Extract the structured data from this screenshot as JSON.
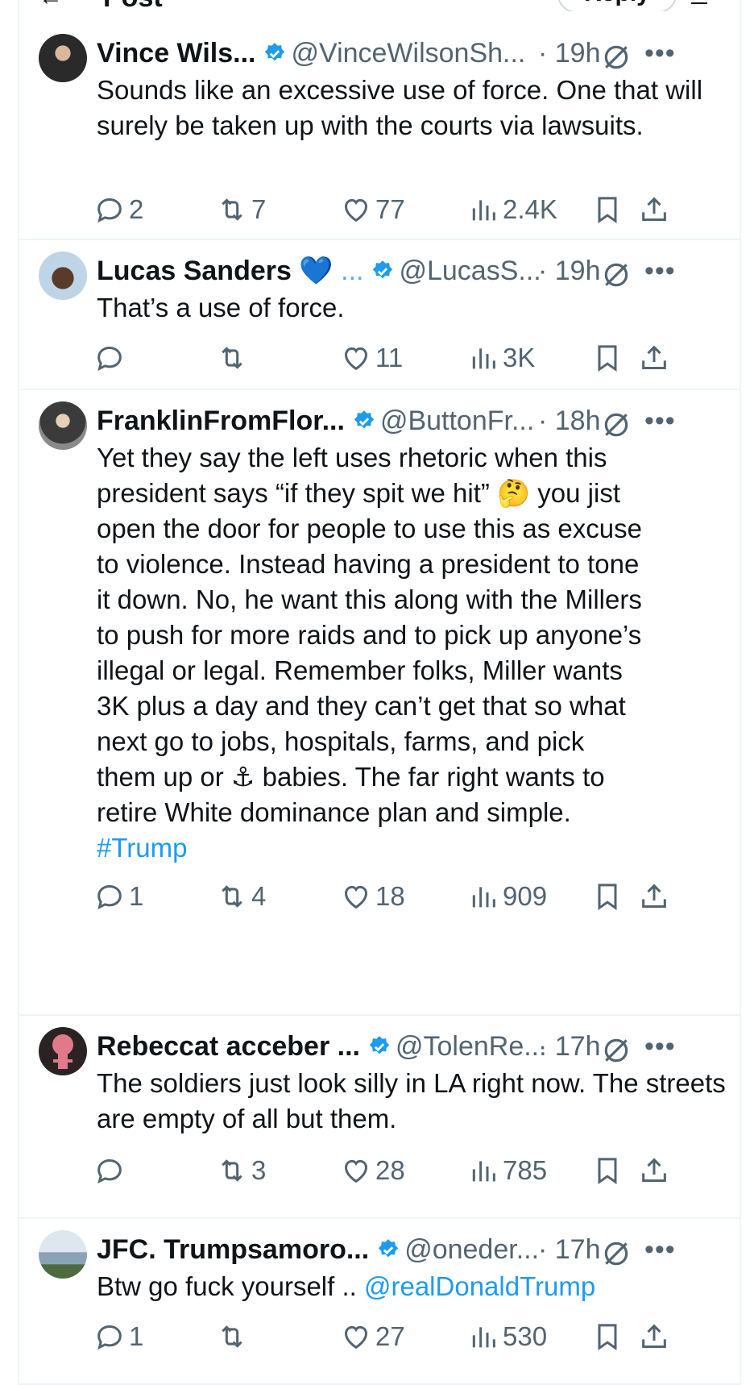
{
  "topbar": {
    "title": "Post",
    "reply_label": "Reply",
    "back": "←"
  },
  "tweets": [
    {
      "name": "Vince Wils...",
      "handle": "@VinceWilsonSh...",
      "time": "· 19h",
      "body": "Sounds like an excessive use of force. One that will surely be taken up with the courts via lawsuits.",
      "replies": "2",
      "reposts": "7",
      "likes": "77",
      "views": "2.4K"
    },
    {
      "name": "Lucas Sanders",
      "name_emoji": "💙 ...",
      "handle": "@LucasS...",
      "time": "· 19h",
      "body": "That’s a use of force.",
      "replies": "",
      "reposts": "",
      "likes": "11",
      "views": "3K"
    },
    {
      "name": "FranklinFromFlor...",
      "handle": "@ButtonFr...",
      "time": "· 18h",
      "body_lines": [
        "Yet they say the left uses rhetoric when this",
        "president says “if they spit we hit” 🤔 you jist",
        "open the door for people to use this as excuse",
        "to violence. Instead having a president to tone",
        "it down. No, he want this along with the Millers",
        "to push for more raids and to pick up anyone’s",
        "illegal or legal. Remember folks, Miller wants",
        "3K plus a day and they can’t get that so what",
        "next go to jobs, hospitals, farms, and pick",
        "them up or ⚓ babies. The far right wants to",
        "retire White dominance plan and simple."
      ],
      "hashtag": "#Trump",
      "replies": "1",
      "reposts": "4",
      "likes": "18",
      "views": "909"
    },
    {
      "name": "Rebeccat acceber ...",
      "handle": "@TolenRe...",
      "time": "· 17h",
      "body": "The soldiers just look silly in LA right now. The streets are empty of all but them.",
      "replies": "",
      "reposts": "3",
      "likes": "28",
      "views": "785"
    },
    {
      "name": "JFC. Trumpsamoro...",
      "handle": "@oneder...",
      "time": "· 17h",
      "body": "Btw go fuck yourself ..",
      "mention": "@realDonaldTrump",
      "replies": "1",
      "reposts": "",
      "likes": "27",
      "views": "530"
    }
  ],
  "colors": {
    "link": "#1d9bf0",
    "verified": "#1d9bf0",
    "muted": "#536471",
    "divider": "#eff3f4"
  }
}
